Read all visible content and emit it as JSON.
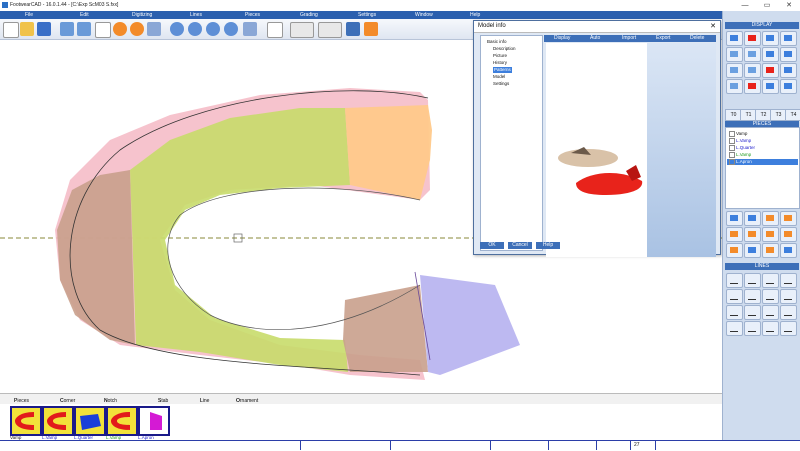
{
  "window": {
    "title": "FootwearCAD - 16.0.1.44 - [C:\\Exp ScM03 S.fxx]",
    "min": "—",
    "max": "▭",
    "close": "✕"
  },
  "menu": [
    "File",
    "Edit",
    "Digitizing",
    "Lines",
    "Pieces",
    "Grading",
    "Settings",
    "Window",
    "Help"
  ],
  "dialog": {
    "title": "Model info",
    "close": "✕",
    "tree": [
      "Basic info",
      "Description",
      "Picture",
      "History",
      "Patterns",
      "Model",
      "Settings"
    ],
    "selected_index": 4,
    "tabs": [
      "Display",
      "Auto",
      "Import",
      "Export",
      "Delete"
    ],
    "buttons": {
      "ok": "OK",
      "cancel": "Cancel",
      "help": "Help"
    }
  },
  "right_panel": {
    "display_header": "DISPLAY",
    "pieces_header": "PIECES",
    "lines_header": "LINES",
    "t_buttons": [
      "T0",
      "T1",
      "T2",
      "T3",
      "T4"
    ],
    "pieces": [
      {
        "name": "Vamp",
        "color": "#111111"
      },
      {
        "name": "L.Vamp",
        "color": "#1a1acc"
      },
      {
        "name": "L.Quarter",
        "color": "#1a1acc"
      },
      {
        "name": "L.Vamp",
        "color": "#1a9a1a"
      },
      {
        "name": "L.Apron",
        "color": "#ffffff",
        "selected": true
      }
    ]
  },
  "bottom_tabs": [
    {
      "label": "Pieces",
      "key": "P"
    },
    {
      "label": "Corner",
      "key": "C"
    },
    {
      "label": "Notch",
      "key": "N"
    },
    {
      "label": "Stab",
      "key": "S"
    },
    {
      "label": "Line",
      "key": "L"
    },
    {
      "label": "Ornament",
      "key": "O"
    }
  ],
  "thumbnails": [
    {
      "label": "Vamp",
      "label_color": "#111111",
      "fill": "#e21b1b"
    },
    {
      "label": "L.Vamp",
      "label_color": "#1a1acc",
      "fill": "#e21b1b"
    },
    {
      "label": "L.Quarter",
      "label_color": "#1a1acc",
      "fill": "#1a3fd8"
    },
    {
      "label": "L.Vamp",
      "label_color": "#1a9a1a",
      "fill": "#e21b1b"
    },
    {
      "label": "L.Apron",
      "label_color": "#1a1acc",
      "fill": "#d41ad4"
    }
  ],
  "status": {
    "page": "27"
  },
  "colors": {
    "menu": "#2b5fae",
    "accent": "#3d6fb8",
    "vamp_green": "#c8dc6a",
    "quarter_brown": "#c9a08c",
    "apron_blue": "#b9b5f0",
    "toe_orange": "#ffc98a",
    "pink": "#f4b8c4"
  }
}
